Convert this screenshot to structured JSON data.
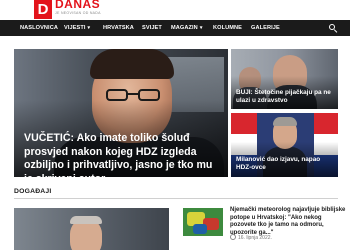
{
  "logo": {
    "letter": "D",
    "word": "DANAS",
    "tagline": "JE NEOVISAN OD NADA"
  },
  "nav": {
    "items": [
      {
        "label": "NASLOVNICA",
        "has_dropdown": false
      },
      {
        "label": "VIJESTI",
        "has_dropdown": true
      },
      {
        "label": "HRVATSKA",
        "has_dropdown": false
      },
      {
        "label": "SVIJET",
        "has_dropdown": false
      },
      {
        "label": "MAGAZIN",
        "has_dropdown": true
      },
      {
        "label": "KOLUMNE",
        "has_dropdown": false
      },
      {
        "label": "GALERIJE",
        "has_dropdown": false
      }
    ],
    "search_icon": "search-icon"
  },
  "featured": {
    "title": "VUČETIĆ: Ako imate toliko šoluđ prosvjed nakon kojeg HDZ izgleda ozbiljno i prihvatljivo, jasno je tko mu je skriveni autor..."
  },
  "side_articles": [
    {
      "title": "BUJI: Štetočine pijačkaju pa ne ulazi u zdravstvo"
    },
    {
      "title": "Milanović dao izjavu, napao HDZ-ovce"
    }
  ],
  "section": {
    "title": "DOGAĐAJI"
  },
  "news_item": {
    "title": "Njemački meteorolog najavljuje biblijske potope u Hrvatskoj: \"Ako nekog pozovete tko je tamo na odmoru, upozorite ga...\"",
    "date": "16. lipnja 2022."
  },
  "colors": {
    "brand": "#e3131b",
    "nav_bg": "#1b1b1b"
  }
}
